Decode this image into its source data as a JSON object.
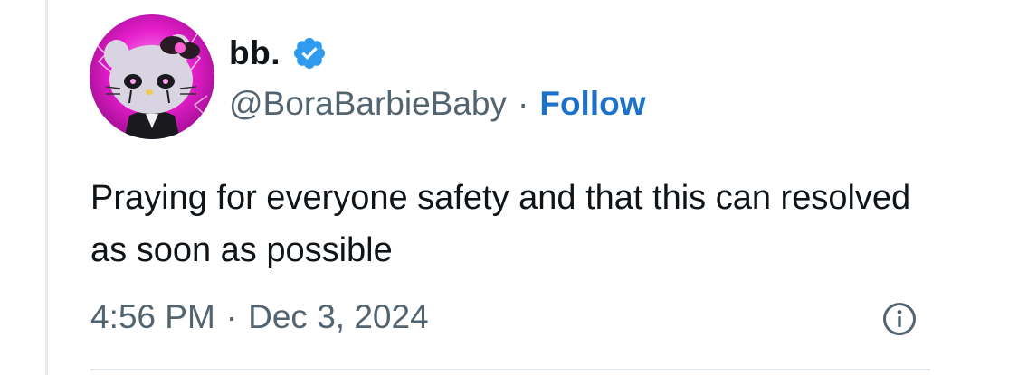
{
  "author": {
    "display_name": "bb.",
    "handle": "@BoraBarbieBaby",
    "separator": "·",
    "follow_label": "Follow",
    "verified": true,
    "verified_color": "#2f9bf0",
    "avatar_icon": "hello-kitty-avatar"
  },
  "tweet": {
    "text": "Praying for everyone safety and that this can resolved as soon as possible",
    "time": "4:56 PM",
    "separator": "·",
    "date": "Dec 3, 2024"
  },
  "icons": {
    "verified": "verified-badge-icon",
    "info": "info-icon"
  },
  "colors": {
    "text": "#0f1419",
    "secondary": "#536471",
    "follow": "#1d71c9",
    "avatar_background": "#e51ecb"
  }
}
